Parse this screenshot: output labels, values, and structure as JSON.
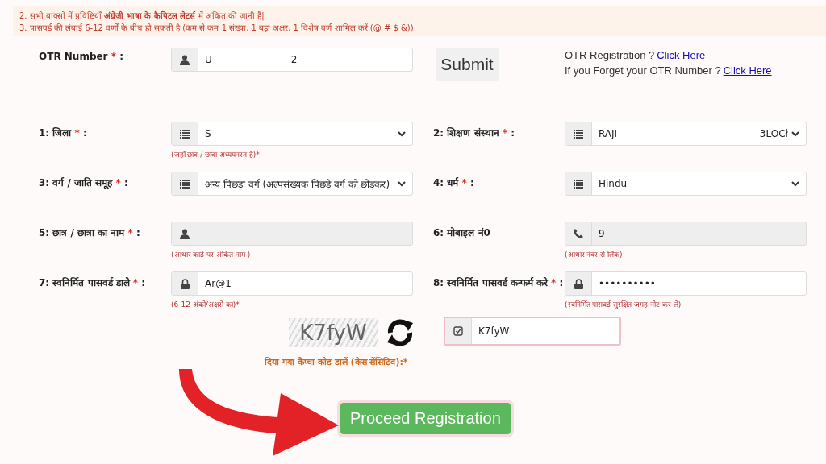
{
  "notice": [
    "2. सभी बाक्सों में प्रविष्टियाँ **अंग्रेजी भाषा के कैपिटल लेटर्स** में अंकित की जानी हैं|",
    "3. पासवर्ड की लंबाई 6-12 वर्णों के बीच हो सकती है (कम से कम 1 संख्या, 1 बड़ा अक्षर, 1 विशेष वर्ण शामिल करें (@ # $ &))|"
  ],
  "otr": {
    "label": "OTR Number",
    "star": "*",
    "colon": ":",
    "value": "U",
    "value_end": "2",
    "submit": "Submit"
  },
  "links": [
    {
      "text": "OTR Registration ?",
      "link": "Click Here"
    },
    {
      "text": "If you Forget your OTR Number ?",
      "link": "Click Here"
    }
  ],
  "rows": [
    [
      {
        "kind": "select",
        "label": "1: जिला",
        "star": "*",
        "colon": ":",
        "value": "S",
        "readonly": false,
        "hint": "(जहाँ छात्र / छात्रा अध्ययनरत है)*"
      },
      {
        "kind": "select",
        "label": "2: शिक्षण संस्थान",
        "star": "*",
        "colon": ":",
        "value": "RAJI",
        "value_end": "3LOCł",
        "readonly": false
      }
    ],
    [
      {
        "kind": "select",
        "label": "3: वर्ग / जाति समूह",
        "star": "*",
        "colon": ":",
        "value": "अन्य पिछड़ा वर्ग (अल्पसंख्यक पिछड़े वर्ग को छोड़कर)",
        "readonly": false
      },
      {
        "kind": "select",
        "label": "4: धर्म",
        "star": "*",
        "colon": ":",
        "value": "Hindu",
        "readonly": false
      }
    ],
    [
      {
        "kind": "text",
        "label": "5: छात्र / छात्रा का नाम",
        "star": "*",
        "colon": ":",
        "readonly": true,
        "hint": "(आधार कार्ड पर अंकित नाम )"
      },
      {
        "kind": "text",
        "label": "6: मोबाइल नं0",
        "value": "9",
        "readonly": true,
        "hint": "(आधार नंबर से लिंक)"
      }
    ],
    [
      {
        "kind": "text",
        "label": "7: स्वनिर्मित पासवर्ड डाले",
        "star": "*",
        "colon": ":",
        "value": "Ar@1",
        "readonly": false,
        "hint": "(6-12 अंको/अक्षरों का)*"
      },
      {
        "kind": "text",
        "label": "8: स्वनिर्मित पासवर्ड कन्फर्म करे",
        "star": "*",
        "colon": ":",
        "value": "••••••••••",
        "readonly": false,
        "hint": "(स्वनिर्मित पासवर्ड सुरक्षित जगह नोट कर लें)"
      }
    ]
  ],
  "captcha": {
    "image_text": "K7fyW",
    "label": "दिया गया कैप्चा कोड डालें (केस सेंसिटिव):*",
    "value": "K7fyW"
  },
  "proceed": "Proceed Registration"
}
